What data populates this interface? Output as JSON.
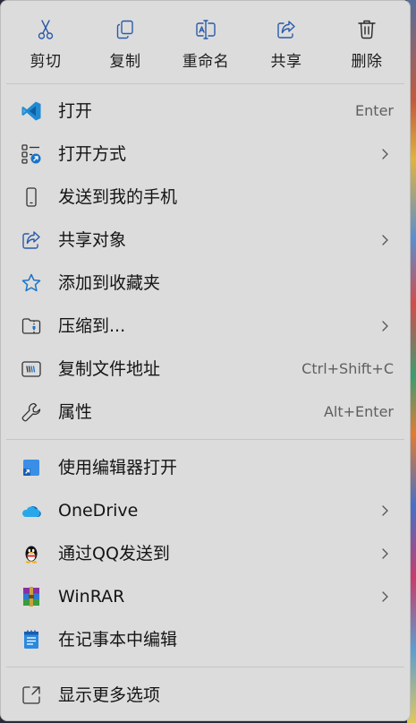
{
  "quick_actions": [
    {
      "label": "剪切",
      "icon": "scissors-icon"
    },
    {
      "label": "复制",
      "icon": "copy-icon"
    },
    {
      "label": "重命名",
      "icon": "rename-icon"
    },
    {
      "label": "共享",
      "icon": "share-icon"
    },
    {
      "label": "删除",
      "icon": "trash-icon"
    }
  ],
  "items": [
    {
      "label": "打开",
      "shortcut": "Enter",
      "icon": "vscode-icon"
    },
    {
      "label": "打开方式",
      "shortcut": "",
      "icon": "open-with-icon",
      "submenu": true
    },
    {
      "label": "发送到我的手机",
      "shortcut": "",
      "icon": "phone-icon"
    },
    {
      "label": "共享对象",
      "shortcut": "",
      "icon": "share-icon",
      "submenu": true
    },
    {
      "label": "添加到收藏夹",
      "shortcut": "",
      "icon": "star-icon"
    },
    {
      "label": "压缩到...",
      "shortcut": "",
      "icon": "zip-folder-icon",
      "submenu": true
    },
    {
      "label": "复制文件地址",
      "shortcut": "Ctrl+Shift+C",
      "icon": "copy-path-icon"
    },
    {
      "label": "属性",
      "shortcut": "Alt+Enter",
      "icon": "wrench-icon"
    },
    {
      "label": "使用编辑器打开",
      "shortcut": "",
      "icon": "editor-icon"
    },
    {
      "label": "OneDrive",
      "shortcut": "",
      "icon": "onedrive-icon",
      "submenu": true
    },
    {
      "label": "通过QQ发送到",
      "shortcut": "",
      "icon": "qq-icon",
      "submenu": true
    },
    {
      "label": "WinRAR",
      "shortcut": "",
      "icon": "winrar-icon",
      "submenu": true
    },
    {
      "label": "在记事本中编辑",
      "shortcut": "",
      "icon": "notepad-icon"
    },
    {
      "label": "显示更多选项",
      "shortcut": "",
      "icon": "more-options-icon"
    }
  ],
  "colors": {
    "menu_bg": "#dcdcdc",
    "accent": "#1a73c9",
    "text": "#141414",
    "shortcut_text": "#5f5f5f"
  }
}
